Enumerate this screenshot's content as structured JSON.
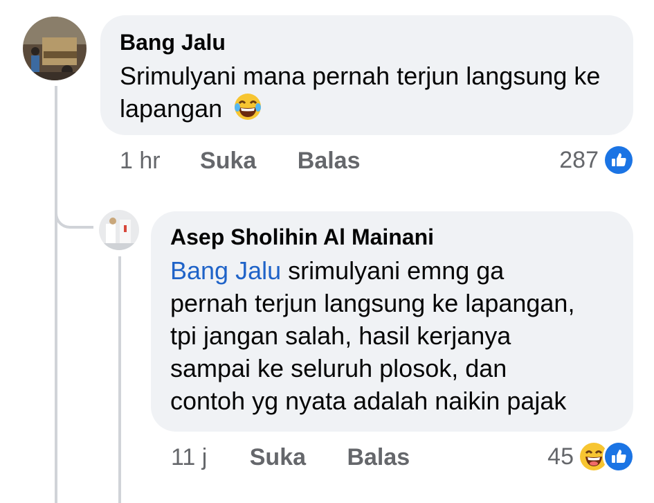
{
  "comments": [
    {
      "author": "Bang Jalu",
      "text": "Srimulyani mana pernah terjun langsung ke lapangan",
      "emoji": "😂",
      "time": "1 hr",
      "like_label": "Suka",
      "reply_label": "Balas",
      "reaction_count": "287",
      "reactions": [
        "like-icon"
      ]
    }
  ],
  "reply": {
    "author": "Asep Sholihin Al Mainani",
    "mention": "Bang Jalu",
    "lines": [
      "srimulyani emng ga",
      "pernah terjun langsung ke lapangan,",
      "tpi jangan salah, hasil kerjanya",
      "sampai ke seluruh plosok, dan",
      "contoh yg nyata adalah naikin pajak"
    ],
    "time": "11 j",
    "like_label": "Suka",
    "reply_label": "Balas",
    "reaction_count": "45",
    "reactions": [
      "haha-icon",
      "like-icon"
    ]
  },
  "colors": {
    "bubble": "#f0f2f5",
    "mention": "#1f63c8",
    "like_blue": "#1b74e4",
    "meta_gray": "#65676b"
  }
}
